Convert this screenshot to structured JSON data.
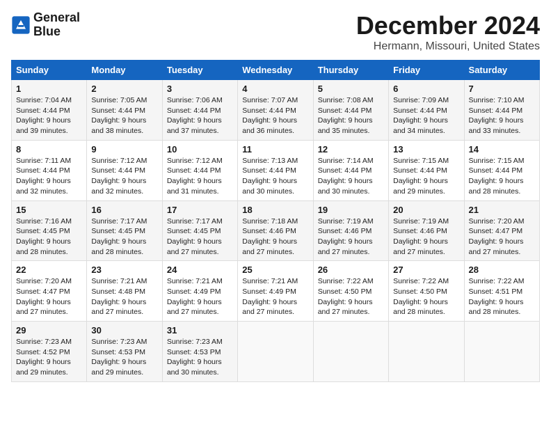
{
  "logo": {
    "line1": "General",
    "line2": "Blue"
  },
  "title": "December 2024",
  "subtitle": "Hermann, Missouri, United States",
  "days_of_week": [
    "Sunday",
    "Monday",
    "Tuesday",
    "Wednesday",
    "Thursday",
    "Friday",
    "Saturday"
  ],
  "weeks": [
    [
      {
        "day": "1",
        "sunrise": "7:04 AM",
        "sunset": "4:44 PM",
        "daylight": "9 hours and 39 minutes."
      },
      {
        "day": "2",
        "sunrise": "7:05 AM",
        "sunset": "4:44 PM",
        "daylight": "9 hours and 38 minutes."
      },
      {
        "day": "3",
        "sunrise": "7:06 AM",
        "sunset": "4:44 PM",
        "daylight": "9 hours and 37 minutes."
      },
      {
        "day": "4",
        "sunrise": "7:07 AM",
        "sunset": "4:44 PM",
        "daylight": "9 hours and 36 minutes."
      },
      {
        "day": "5",
        "sunrise": "7:08 AM",
        "sunset": "4:44 PM",
        "daylight": "9 hours and 35 minutes."
      },
      {
        "day": "6",
        "sunrise": "7:09 AM",
        "sunset": "4:44 PM",
        "daylight": "9 hours and 34 minutes."
      },
      {
        "day": "7",
        "sunrise": "7:10 AM",
        "sunset": "4:44 PM",
        "daylight": "9 hours and 33 minutes."
      }
    ],
    [
      {
        "day": "8",
        "sunrise": "7:11 AM",
        "sunset": "4:44 PM",
        "daylight": "9 hours and 32 minutes."
      },
      {
        "day": "9",
        "sunrise": "7:12 AM",
        "sunset": "4:44 PM",
        "daylight": "9 hours and 32 minutes."
      },
      {
        "day": "10",
        "sunrise": "7:12 AM",
        "sunset": "4:44 PM",
        "daylight": "9 hours and 31 minutes."
      },
      {
        "day": "11",
        "sunrise": "7:13 AM",
        "sunset": "4:44 PM",
        "daylight": "9 hours and 30 minutes."
      },
      {
        "day": "12",
        "sunrise": "7:14 AM",
        "sunset": "4:44 PM",
        "daylight": "9 hours and 30 minutes."
      },
      {
        "day": "13",
        "sunrise": "7:15 AM",
        "sunset": "4:44 PM",
        "daylight": "9 hours and 29 minutes."
      },
      {
        "day": "14",
        "sunrise": "7:15 AM",
        "sunset": "4:44 PM",
        "daylight": "9 hours and 28 minutes."
      }
    ],
    [
      {
        "day": "15",
        "sunrise": "7:16 AM",
        "sunset": "4:45 PM",
        "daylight": "9 hours and 28 minutes."
      },
      {
        "day": "16",
        "sunrise": "7:17 AM",
        "sunset": "4:45 PM",
        "daylight": "9 hours and 28 minutes."
      },
      {
        "day": "17",
        "sunrise": "7:17 AM",
        "sunset": "4:45 PM",
        "daylight": "9 hours and 27 minutes."
      },
      {
        "day": "18",
        "sunrise": "7:18 AM",
        "sunset": "4:46 PM",
        "daylight": "9 hours and 27 minutes."
      },
      {
        "day": "19",
        "sunrise": "7:19 AM",
        "sunset": "4:46 PM",
        "daylight": "9 hours and 27 minutes."
      },
      {
        "day": "20",
        "sunrise": "7:19 AM",
        "sunset": "4:46 PM",
        "daylight": "9 hours and 27 minutes."
      },
      {
        "day": "21",
        "sunrise": "7:20 AM",
        "sunset": "4:47 PM",
        "daylight": "9 hours and 27 minutes."
      }
    ],
    [
      {
        "day": "22",
        "sunrise": "7:20 AM",
        "sunset": "4:47 PM",
        "daylight": "9 hours and 27 minutes."
      },
      {
        "day": "23",
        "sunrise": "7:21 AM",
        "sunset": "4:48 PM",
        "daylight": "9 hours and 27 minutes."
      },
      {
        "day": "24",
        "sunrise": "7:21 AM",
        "sunset": "4:49 PM",
        "daylight": "9 hours and 27 minutes."
      },
      {
        "day": "25",
        "sunrise": "7:21 AM",
        "sunset": "4:49 PM",
        "daylight": "9 hours and 27 minutes."
      },
      {
        "day": "26",
        "sunrise": "7:22 AM",
        "sunset": "4:50 PM",
        "daylight": "9 hours and 27 minutes."
      },
      {
        "day": "27",
        "sunrise": "7:22 AM",
        "sunset": "4:50 PM",
        "daylight": "9 hours and 28 minutes."
      },
      {
        "day": "28",
        "sunrise": "7:22 AM",
        "sunset": "4:51 PM",
        "daylight": "9 hours and 28 minutes."
      }
    ],
    [
      {
        "day": "29",
        "sunrise": "7:23 AM",
        "sunset": "4:52 PM",
        "daylight": "9 hours and 29 minutes."
      },
      {
        "day": "30",
        "sunrise": "7:23 AM",
        "sunset": "4:53 PM",
        "daylight": "9 hours and 29 minutes."
      },
      {
        "day": "31",
        "sunrise": "7:23 AM",
        "sunset": "4:53 PM",
        "daylight": "9 hours and 30 minutes."
      },
      null,
      null,
      null,
      null
    ]
  ]
}
